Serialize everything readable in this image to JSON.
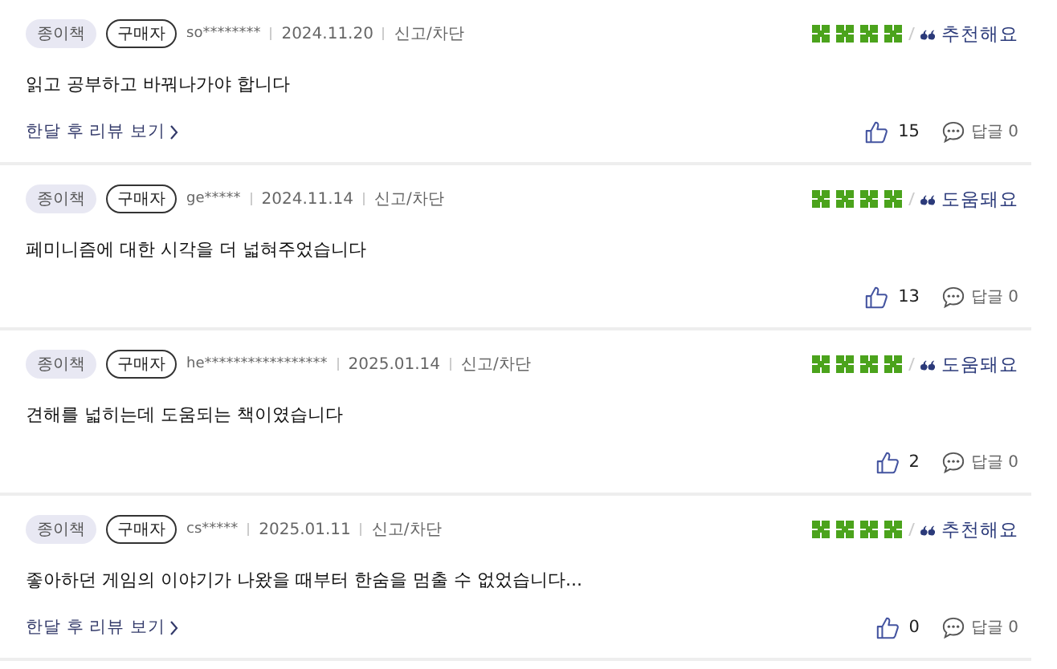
{
  "reviews": [
    {
      "format": "종이책",
      "badge": "구매자",
      "user": "so********",
      "date": "2024.11.20",
      "report": "신고/차단",
      "stars": 4,
      "tag": "추천해요",
      "text": "읽고 공부하고 바꿔나가야 합니다",
      "link": "한달 후 리뷰 보기",
      "likes": "15",
      "reply_label": "답글",
      "replies": "0"
    },
    {
      "format": "종이책",
      "badge": "구매자",
      "user": "ge*****",
      "date": "2024.11.14",
      "report": "신고/차단",
      "stars": 4,
      "tag": "도움돼요",
      "text": "페미니즘에 대한 시각을 더 넓혀주었습니다",
      "likes": "13",
      "reply_label": "답글",
      "replies": "0"
    },
    {
      "format": "종이책",
      "badge": "구매자",
      "user": "he*****************",
      "date": "2025.01.14",
      "report": "신고/차단",
      "stars": 4,
      "tag": "도움돼요",
      "text": "견해를 넓히는데 도움되는 책이였습니다",
      "likes": "2",
      "reply_label": "답글",
      "replies": "0"
    },
    {
      "format": "종이책",
      "badge": "구매자",
      "user": "cs*****",
      "date": "2025.01.11",
      "report": "신고/차단",
      "stars": 4,
      "tag": "추천해요",
      "text": "좋아하던 게임의 이야기가 나왔을 때부터 한숨을 멈출 수 없었습니다...",
      "link": "한달 후 리뷰 보기",
      "likes": "0",
      "reply_label": "답글",
      "replies": "0"
    }
  ]
}
